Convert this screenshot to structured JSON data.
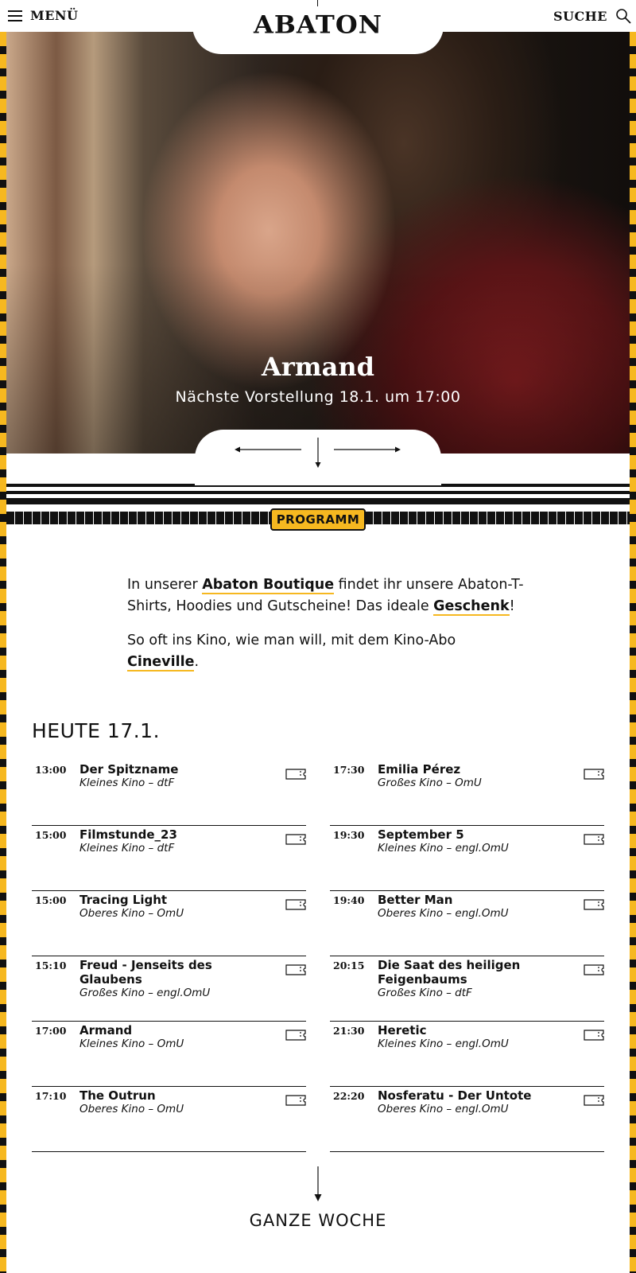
{
  "header": {
    "menu_label": "MENÜ",
    "logo": "ABATON",
    "search_label": "SUCHE"
  },
  "hero": {
    "title": "Armand",
    "subtitle": "Nächste Vorstellung 18.1. um 17:00"
  },
  "program_badge": "PROGRAMM",
  "intro": {
    "p1_a": "In unserer ",
    "p1_link1": "Abaton Boutique",
    "p1_b": " findet ihr unsere Abaton-T-Shirts, Hoodies und Gutscheine! Das ideale ",
    "p1_link2": "Geschenk",
    "p1_c": "!",
    "p2_a": "So oft ins Kino, wie man will, mit dem Kino-Abo ",
    "p2_link": "Cineville",
    "p2_b": "."
  },
  "schedule": {
    "heading": "HEUTE 17.1.",
    "left": [
      {
        "time": "13:00",
        "title": "Der Spitzname",
        "venue": "Kleines Kino – dtF"
      },
      {
        "time": "15:00",
        "title": "Filmstunde_23",
        "venue": "Kleines Kino – dtF"
      },
      {
        "time": "15:00",
        "title": "Tracing Light",
        "venue": "Oberes Kino – OmU"
      },
      {
        "time": "15:10",
        "title": "Freud - Jenseits des Glaubens",
        "venue": "Großes Kino – engl.OmU"
      },
      {
        "time": "17:00",
        "title": "Armand",
        "venue": "Kleines Kino – OmU"
      },
      {
        "time": "17:10",
        "title": "The Outrun",
        "venue": "Oberes Kino – OmU"
      }
    ],
    "right": [
      {
        "time": "17:30",
        "title": "Emilia Pérez",
        "venue": "Großes Kino – OmU"
      },
      {
        "time": "19:30",
        "title": "September 5",
        "venue": "Kleines Kino – engl.OmU"
      },
      {
        "time": "19:40",
        "title": "Better Man",
        "venue": "Oberes Kino – engl.OmU"
      },
      {
        "time": "20:15",
        "title": "Die Saat des heiligen Feigenbaums",
        "venue": "Großes Kino – dtF"
      },
      {
        "time": "21:30",
        "title": "Heretic",
        "venue": "Kleines Kino – engl.OmU"
      },
      {
        "time": "22:20",
        "title": "Nosferatu - Der Untote",
        "venue": "Oberes Kino – engl.OmU"
      }
    ]
  },
  "week_link": "GANZE WOCHE",
  "colors": {
    "accent": "#f6b820",
    "ink": "#111111"
  }
}
